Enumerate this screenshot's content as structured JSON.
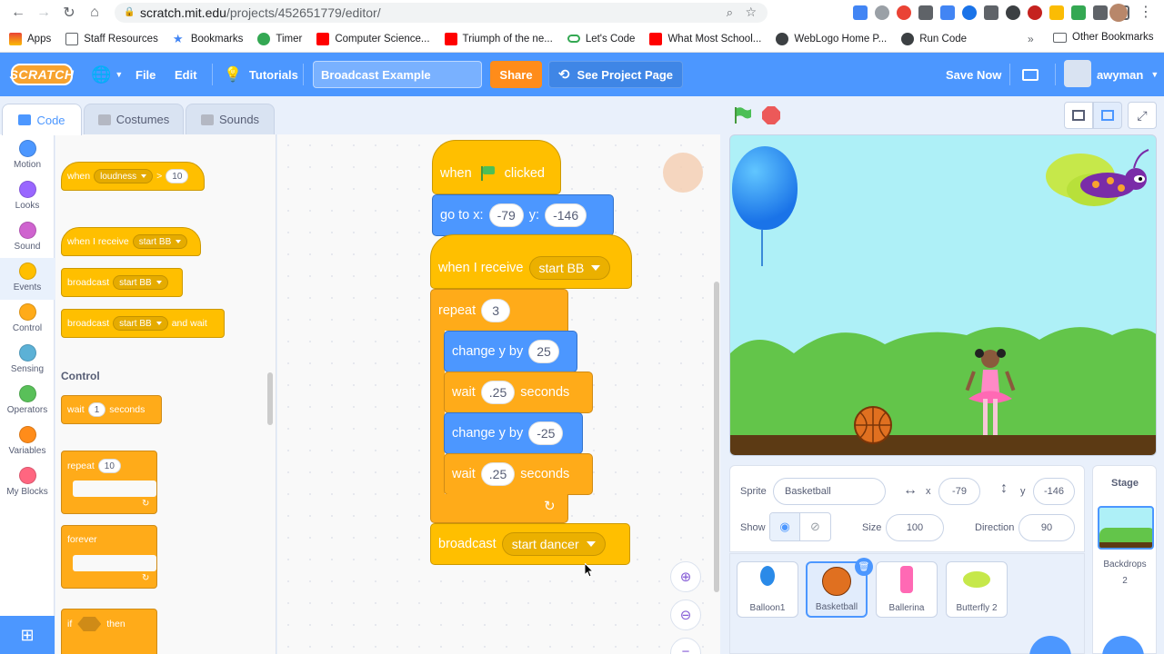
{
  "browser": {
    "url_host": "scratch.mit.edu",
    "url_path": "/projects/452651779/editor/",
    "bookmarks": [
      {
        "label": "Apps",
        "color": "#ea4335"
      },
      {
        "label": "Staff Resources",
        "color": "#4285f4"
      },
      {
        "label": "Bookmarks",
        "color": "#4285f4"
      },
      {
        "label": "Timer",
        "color": "#34a853"
      },
      {
        "label": "Computer Science...",
        "color": "#ff0000"
      },
      {
        "label": "Triumph of the ne...",
        "color": "#ff0000"
      },
      {
        "label": "Let's Code",
        "color": "#34a853"
      },
      {
        "label": "What Most School...",
        "color": "#ff0000"
      },
      {
        "label": "WebLogo Home P...",
        "color": "#5f6368"
      },
      {
        "label": "Run Code",
        "color": "#5f6368"
      }
    ],
    "more": "»",
    "other_bookmarks": "Other Bookmarks"
  },
  "menubar": {
    "logo": "SCRATCH",
    "file": "File",
    "edit": "Edit",
    "tutorials": "Tutorials",
    "project_title": "Broadcast Example",
    "share": "Share",
    "see_project": "See Project Page",
    "save_now": "Save Now",
    "username": "awyman",
    "accent": "#4c97ff"
  },
  "tabs": {
    "code": "Code",
    "costumes": "Costumes",
    "sounds": "Sounds"
  },
  "categories": [
    {
      "label": "Motion",
      "color": "#4c97ff"
    },
    {
      "label": "Looks",
      "color": "#9966ff"
    },
    {
      "label": "Sound",
      "color": "#cf63cf"
    },
    {
      "label": "Events",
      "color": "#ffbf00"
    },
    {
      "label": "Control",
      "color": "#ffab19"
    },
    {
      "label": "Sensing",
      "color": "#5cb1d6"
    },
    {
      "label": "Operators",
      "color": "#59c059"
    },
    {
      "label": "Variables",
      "color": "#ff8c1a"
    },
    {
      "label": "My Blocks",
      "color": "#ff6680"
    }
  ],
  "palette": {
    "when_loudness": {
      "when": "when",
      "sensor": "loudness",
      "op": ">",
      "value": "10"
    },
    "when_receive": {
      "text": "when I receive",
      "msg": "start BB"
    },
    "broadcast": {
      "text": "broadcast",
      "msg": "start BB"
    },
    "broadcast_wait": {
      "text": "broadcast",
      "msg": "start BB",
      "suffix": "and wait"
    },
    "control_heading": "Control",
    "wait": {
      "text": "wait",
      "value": "1",
      "suffix": "seconds"
    },
    "repeat": {
      "text": "repeat",
      "value": "10"
    },
    "forever": "forever",
    "if_then": {
      "if": "if",
      "then": "then"
    }
  },
  "script": {
    "when_flag": {
      "when": "when",
      "clicked": "clicked"
    },
    "goto": {
      "text": "go to x:",
      "x": "-79",
      "ylabel": "y:",
      "y": "-146"
    },
    "when_receive": {
      "text": "when I receive",
      "msg": "start BB"
    },
    "repeat": {
      "text": "repeat",
      "value": "3"
    },
    "change1": {
      "text": "change y by",
      "value": "25"
    },
    "wait1": {
      "text": "wait",
      "value": ".25",
      "suffix": "seconds"
    },
    "change2": {
      "text": "change y by",
      "value": "-25"
    },
    "wait2": {
      "text": "wait",
      "value": ".25",
      "suffix": "seconds"
    },
    "broadcast": {
      "text": "broadcast",
      "msg": "start dancer"
    }
  },
  "sprite_info": {
    "sprite_label": "Sprite",
    "sprite_name": "Basketball",
    "x_label": "x",
    "x_value": "-79",
    "y_label": "y",
    "y_value": "-146",
    "show_label": "Show",
    "size_label": "Size",
    "size_value": "100",
    "direction_label": "Direction",
    "direction_value": "90"
  },
  "sprites": [
    {
      "name": "Balloon1"
    },
    {
      "name": "Basketball"
    },
    {
      "name": "Ballerina"
    },
    {
      "name": "Butterfly 2"
    }
  ],
  "stage_panel": {
    "title": "Stage",
    "backdrops_label": "Backdrops",
    "backdrops_count": "2"
  }
}
